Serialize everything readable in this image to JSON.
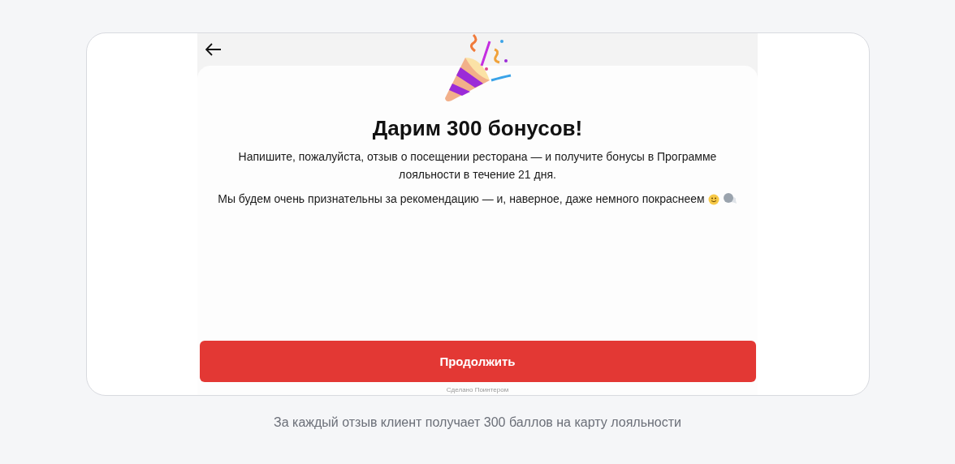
{
  "screen": {
    "title": "Дарим 300 бонусов!",
    "paragraphs": [
      "Напишите, пожалуйста, отзыв о посещении ресторана — и получите бонусы в Программе лояльности в течение 21 дня.",
      "Мы будем очень признательны за рекомендацию — и, наверное, даже немного покраснеем"
    ],
    "button": "Продолжить",
    "footer": "Сделано Поинтером"
  },
  "caption": "За каждый отзыв клиент получает 300 баллов на карту лояльности"
}
